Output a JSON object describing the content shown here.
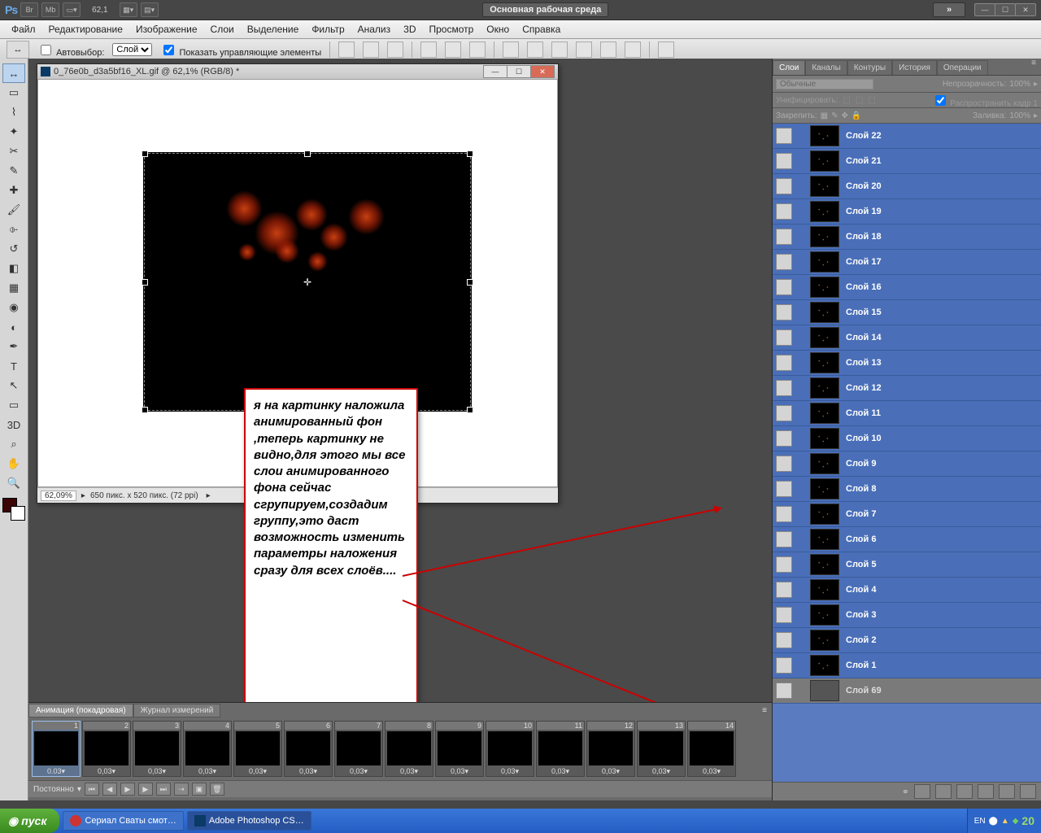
{
  "appbar": {
    "zoom": "62,1",
    "workspace": "Основная рабочая среда"
  },
  "menu": {
    "file": "Файл",
    "edit": "Редактирование",
    "image": "Изображение",
    "layer": "Слои",
    "select": "Выделение",
    "filter": "Фильтр",
    "analysis": "Анализ",
    "threeD": "3D",
    "view": "Просмотр",
    "window": "Окно",
    "help": "Справка"
  },
  "opt": {
    "autoselect": "Автовыбор:",
    "autoselect_mode": "Слой",
    "showctrl": "Показать управляющие элементы"
  },
  "doc": {
    "title": "0_76e0b_d3a5bf16_XL.gif @ 62,1% (RGB/8) *",
    "zoom": "62,09%",
    "info": "650 пикс. x 520 пикс. (72 ppi)"
  },
  "annot": {
    "text": "я на картинку наложила анимированный фон ,теперь картинку не видно,для этого мы все слои анимированного фона сейчас сгрупируем,создадим группу,это даст возможность изменить параметры наложения сразу для всех слоёв...."
  },
  "anim": {
    "tab1": "Анимация (покадровая)",
    "tab2": "Журнал измерений",
    "loop": "Постоянно",
    "dur0": "0.03",
    "dur": "0,03",
    "frames": [
      1,
      2,
      3,
      4,
      5,
      6,
      7,
      8,
      9,
      10,
      11,
      12,
      13,
      14
    ]
  },
  "panels": {
    "tabs": {
      "layers": "Слои",
      "channels": "Каналы",
      "paths": "Контуры",
      "history": "История",
      "actions": "Операции"
    },
    "blend": "Обычные",
    "opacity_lbl": "Непрозрачность:",
    "opacity": "100%",
    "unify": "Унифицировать:",
    "propagate": "Распространить кадр 1",
    "lock": "Закрепить:",
    "fill_lbl": "Заливка:",
    "fill": "100%",
    "layers_list": [
      "Слой 22",
      "Слой 21",
      "Слой 20",
      "Слой 19",
      "Слой 18",
      "Слой 17",
      "Слой 16",
      "Слой 15",
      "Слой 14",
      "Слой 13",
      "Слой 12",
      "Слой 11",
      "Слой 10",
      "Слой 9",
      "Слой 8",
      "Слой 7",
      "Слой 6",
      "Слой 5",
      "Слой 4",
      "Слой 3",
      "Слой 2",
      "Слой 1"
    ],
    "last_layer": "Слой 69"
  },
  "taskbar": {
    "start": "пуск",
    "t1": "Сериал Сваты смот…",
    "t2": "Adobe Photoshop CS…",
    "lang": "EN",
    "clock": "20"
  }
}
